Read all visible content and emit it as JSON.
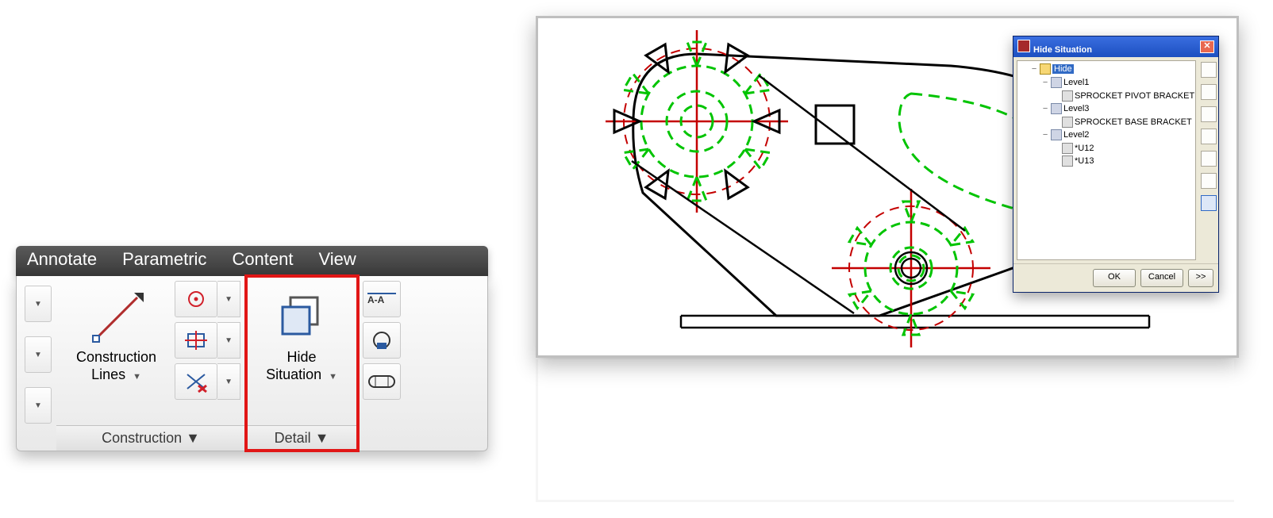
{
  "ribbon_tabs": {
    "annotate": "Annotate",
    "parametric": "Parametric",
    "content": "Content",
    "view": "View"
  },
  "panels": {
    "construction": {
      "tooltip_edge": "▼",
      "construction_lines_l1": "Construction",
      "construction_lines_l2": "Lines",
      "footer": "Construction  ▼"
    },
    "detail": {
      "hide_situation_l1": "Hide",
      "hide_situation_l2": "Situation",
      "footer": "Detail  ▼"
    }
  },
  "dialog": {
    "title": "Hide Situation",
    "root": "Hide",
    "levels": {
      "level1": "Level1",
      "level1_item": "SPROCKET PIVOT BRACKET",
      "level3": "Level3",
      "level3_item": "SPROCKET BASE BRACKET",
      "level2": "Level2",
      "level2_item1": "*U12",
      "level2_item2": "*U13"
    },
    "buttons": {
      "ok": "OK",
      "cancel": "Cancel",
      "more": ">>"
    }
  }
}
